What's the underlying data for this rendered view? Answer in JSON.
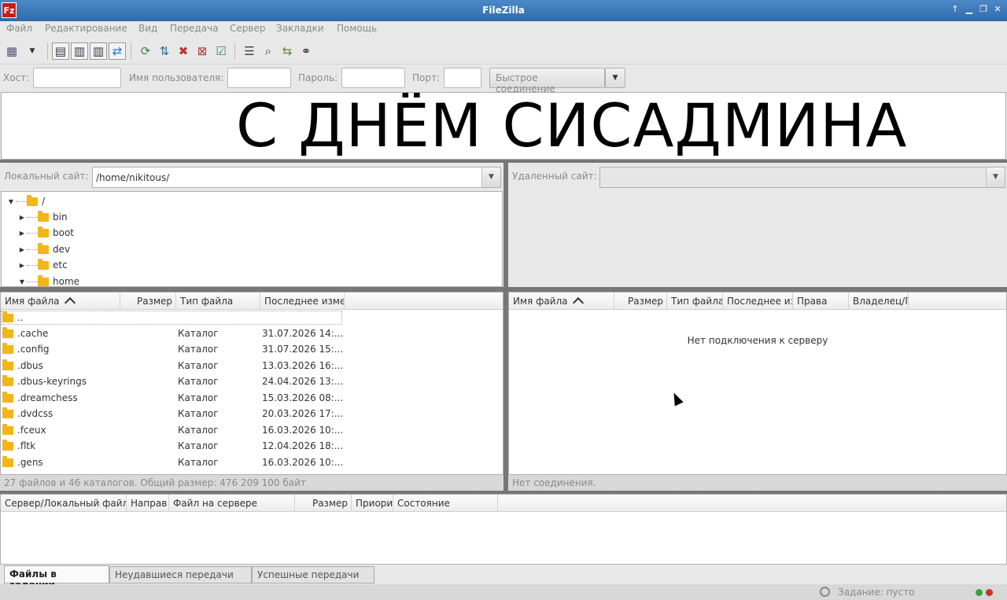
{
  "window": {
    "title": "FileZilla",
    "app_icon": "Fz"
  },
  "menu": [
    "Файл",
    "Редактирование",
    "Вид",
    "Передача",
    "Сервер",
    "Закладки",
    "Помощь"
  ],
  "quickconnect": {
    "host_label": "Хост:",
    "user_label": "Имя пользователя:",
    "password_label": "Пароль:",
    "port_label": "Порт:",
    "connect_button": "Быстрое соединение",
    "host_value": "",
    "user_value": "",
    "password_value": "",
    "port_value": ""
  },
  "banner": {
    "text": "С ДНЁМ СИСАДМИНА"
  },
  "local": {
    "site_label": "Локальный сайт:",
    "path": "/home/nikitous/",
    "tree": [
      {
        "name": "/",
        "expanded": true
      },
      {
        "name": "bin",
        "expanded": false
      },
      {
        "name": "boot",
        "expanded": false
      },
      {
        "name": "dev",
        "expanded": false
      },
      {
        "name": "etc",
        "expanded": false
      },
      {
        "name": "home",
        "expanded": true
      }
    ],
    "columns": {
      "name": "Имя файла",
      "size": "Размер",
      "type": "Тип файла",
      "modified": "Последнее изме"
    },
    "files": [
      {
        "name": "..",
        "type": "",
        "modified": ""
      },
      {
        "name": ".cache",
        "type": "Каталог",
        "modified": "31.07.2026 14:..."
      },
      {
        "name": ".config",
        "type": "Каталог",
        "modified": "31.07.2026 15:..."
      },
      {
        "name": ".dbus",
        "type": "Каталог",
        "modified": "13.03.2026 16:..."
      },
      {
        "name": ".dbus-keyrings",
        "type": "Каталог",
        "modified": "24.04.2026 13:..."
      },
      {
        "name": ".dreamchess",
        "type": "Каталог",
        "modified": "15.03.2026 08:..."
      },
      {
        "name": ".dvdcss",
        "type": "Каталог",
        "modified": "20.03.2026 17:..."
      },
      {
        "name": ".fceux",
        "type": "Каталог",
        "modified": "16.03.2026 10:..."
      },
      {
        "name": ".fltk",
        "type": "Каталог",
        "modified": "12.04.2026 18:..."
      },
      {
        "name": ".gens",
        "type": "Каталог",
        "modified": "16.03.2026 10:..."
      }
    ],
    "status": "27 файлов и 46 каталогов. Общий размер: 476 209 100 байт"
  },
  "remote": {
    "site_label": "Удаленный сайт:",
    "path": "",
    "columns": {
      "name": "Имя файла",
      "size": "Размер",
      "type": "Тип файла",
      "modified": "Последнее из",
      "perms": "Права",
      "owner": "Владелец/Г"
    },
    "empty_message": "Нет подключения к серверу",
    "status": "Нет соединения."
  },
  "queue": {
    "columns": {
      "server": "Сервер/Локальный файл",
      "direction": "Направ",
      "remote_file": "Файл на сервере",
      "size": "Размер",
      "priority": "Приори",
      "state": "Состояние"
    }
  },
  "tabs": [
    "Файлы в задании",
    "Неудавшиеся передачи",
    "Успешные передачи"
  ],
  "statusbar": {
    "task": "Задание: пусто",
    "led1": "#3aa13a",
    "led2": "#c0392b"
  }
}
